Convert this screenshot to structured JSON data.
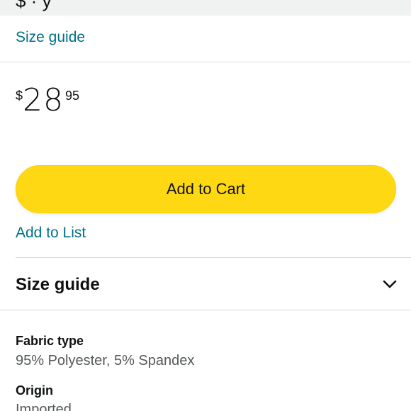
{
  "header": {
    "cut_text": "$ · y"
  },
  "size_guide_link": "Size guide",
  "price": {
    "symbol": "$",
    "whole": "28",
    "fraction": "95"
  },
  "buttons": {
    "add_to_cart": "Add to Cart",
    "add_to_list": "Add to List"
  },
  "accordion": {
    "title": "Size guide",
    "icon": "chevron-down-icon"
  },
  "specs": [
    {
      "label": "Fabric type",
      "value": "95% Polyester, 5% Spandex"
    },
    {
      "label": "Origin",
      "value": "Imported"
    }
  ],
  "colors": {
    "link": "#007185",
    "add_to_cart_bg": "#FFD814",
    "divider": "#D5D9D9",
    "text": "#0F1111",
    "muted_text": "#565959"
  }
}
